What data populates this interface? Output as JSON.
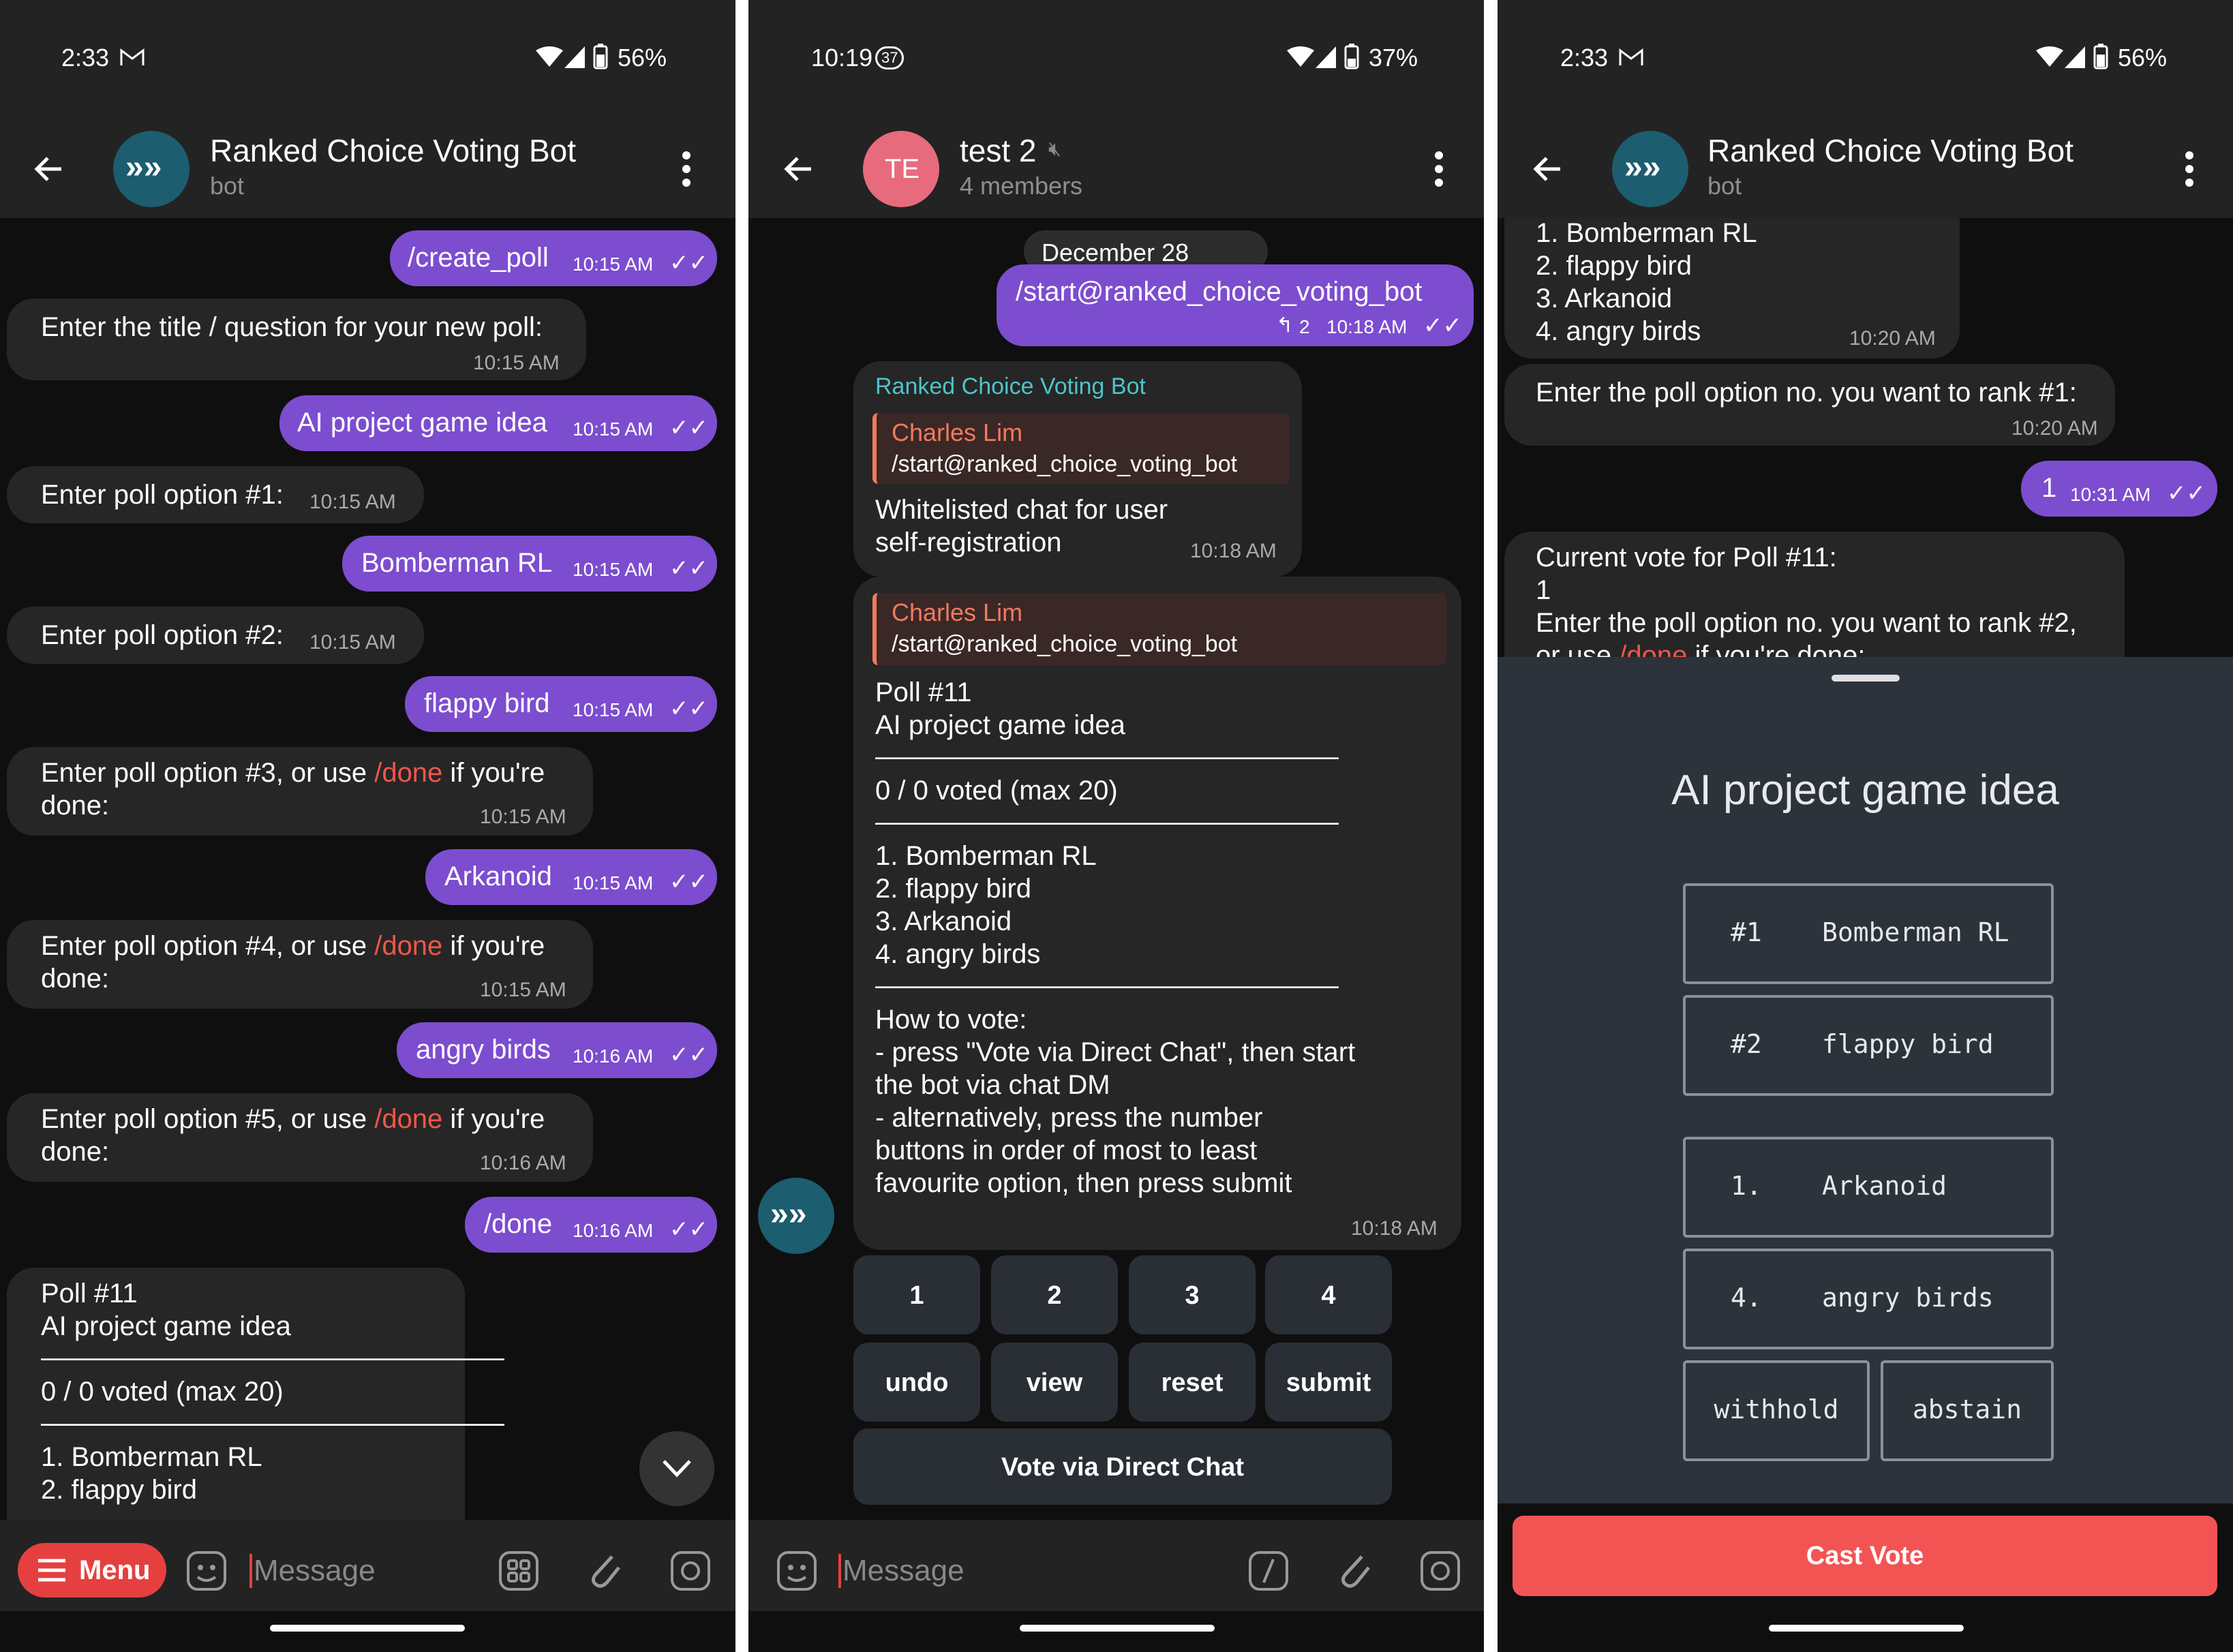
{
  "colors": {
    "bg": "#0f0f0f",
    "bar": "#232323",
    "bubble_in": "#262626",
    "bubble_out": "#7c4dcf",
    "link": "#f0564a",
    "bot_name": "#4fc3c9",
    "reply_name": "#f07a5e",
    "sheet": "#2d333b",
    "cast_vote": "#f25454",
    "avatar_bot": "#1c5d6f",
    "avatar_te": "#e86b7d"
  },
  "p1": {
    "status": {
      "time": "2:33",
      "battery": "56%"
    },
    "header": {
      "title": "Ranked Choice Voting Bot",
      "subtitle": "bot"
    },
    "msgs": {
      "m1": {
        "text": "/create_poll",
        "time": "10:15 AM"
      },
      "m2": {
        "text": "Enter the title / question for your new poll:",
        "time": "10:15 AM"
      },
      "m3": {
        "text": "AI project game idea",
        "time": "10:15 AM"
      },
      "m4": {
        "text": "Enter poll option #1:",
        "time": "10:15 AM"
      },
      "m5": {
        "text": "Bomberman RL",
        "time": "10:15 AM"
      },
      "m6": {
        "text": "Enter poll option #2:",
        "time": "10:15 AM"
      },
      "m7": {
        "text": "flappy bird",
        "time": "10:15 AM"
      },
      "m8": {
        "a": "Enter poll option #3, or use ",
        "link": "/done",
        "b": " if you're",
        "c": "done:",
        "time": "10:15 AM"
      },
      "m9": {
        "text": "Arkanoid",
        "time": "10:15 AM"
      },
      "m10": {
        "a": "Enter poll option #4, or use ",
        "link": "/done",
        "b": " if you're",
        "c": "done:",
        "time": "10:15 AM"
      },
      "m11": {
        "text": "angry birds",
        "time": "10:16 AM"
      },
      "m12": {
        "a": "Enter poll option #5, or use ",
        "link": "/done",
        "b": " if you're",
        "c": "done:",
        "time": "10:16 AM"
      },
      "m13": {
        "text": "/done",
        "time": "10:16 AM"
      }
    },
    "poll": {
      "l1": "Poll #11",
      "l2": "AI project game idea",
      "sep": "—————————————————",
      "l3": "0 / 0 voted (max 20)",
      "l4": "1. Bomberman RL",
      "l5": "2. flappy bird"
    },
    "input": {
      "menu": "Menu",
      "placeholder": "Message"
    }
  },
  "p2": {
    "status": {
      "time": "10:19",
      "notif": "37",
      "battery": "37%"
    },
    "header": {
      "avatar": "TE",
      "title": "test 2",
      "subtitle": "4 members"
    },
    "date": "December 28",
    "start": {
      "text": "/start@ranked_choice_voting_bot",
      "replies": "2",
      "time": "10:18 AM"
    },
    "reply1": {
      "sender": "Ranked Choice Voting Bot",
      "quote_name": "Charles Lim",
      "quote_text": "/start@ranked_choice_voting_bot",
      "l1": "Whitelisted chat for user",
      "l2": "self-registration",
      "time": "10:18 AM"
    },
    "poll": {
      "quote_name": "Charles Lim",
      "quote_text": "/start@ranked_choice_voting_bot",
      "l1": "Poll #11",
      "l2": "AI project game idea",
      "sep": "—————————————————",
      "l3": "0 / 0 voted (max 20)",
      "o1": "1. Bomberman RL",
      "o2": "2. flappy bird",
      "o3": "3. Arkanoid",
      "o4": "4. angry birds",
      "h1": "How to vote:",
      "h2": "- press \"Vote via Direct Chat\", then start",
      "h3": "the bot via chat DM",
      "h4": "- alternatively, press the number",
      "h5": "buttons in order of most to least",
      "h6": "favourite option, then press submit",
      "time": "10:18 AM"
    },
    "keyboard": {
      "k1": "1",
      "k2": "2",
      "k3": "3",
      "k4": "4",
      "undo": "undo",
      "view": "view",
      "reset": "reset",
      "submit": "submit",
      "direct": "Vote via Direct Chat"
    },
    "input": {
      "placeholder": "Message"
    }
  },
  "p3": {
    "status": {
      "time": "2:33",
      "battery": "56%"
    },
    "header": {
      "title": "Ranked Choice Voting Bot",
      "subtitle": "bot"
    },
    "list": {
      "o1": "1. Bomberman RL",
      "o2": "2. flappy bird",
      "o3": "3. Arkanoid",
      "o4": "4. angry birds",
      "time": "10:20 AM"
    },
    "ask1": {
      "text": "Enter the poll option no. you want to rank #1:",
      "time": "10:20 AM"
    },
    "ans": {
      "text": "1",
      "time": "10:31 AM"
    },
    "cur": {
      "l1": "Current vote for Poll #11:",
      "l2": "1",
      "l3": "Enter the poll option no. you want to rank #2,",
      "l4a": "or use ",
      "l4link": "/done",
      "l4b": " if you're done:"
    },
    "sheet": {
      "title": "AI project game idea",
      "o1n": "#1",
      "o1t": "Bomberman RL",
      "o2n": "#2",
      "o2t": "flappy bird",
      "o3n": "1.",
      "o3t": "Arkanoid",
      "o4n": "4.",
      "o4t": "angry birds",
      "withhold": "withhold",
      "abstain": "abstain",
      "cast": "Cast Vote"
    }
  }
}
